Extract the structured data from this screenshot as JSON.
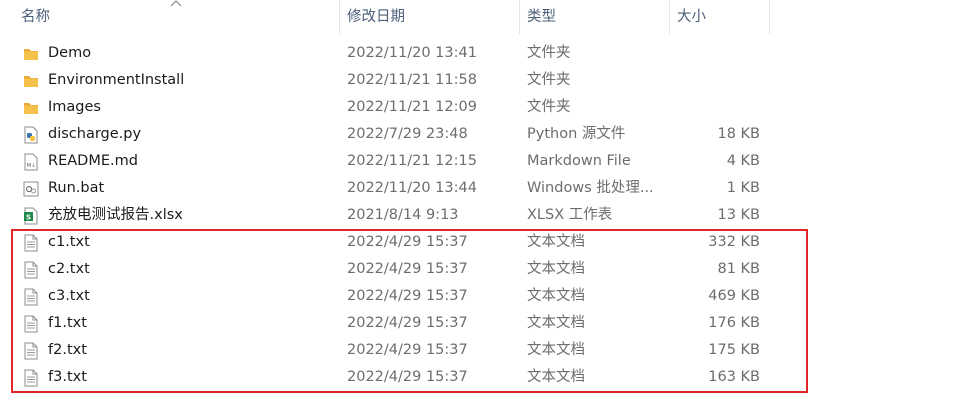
{
  "header": {
    "name": "名称",
    "date": "修改日期",
    "type": "类型",
    "size": "大小"
  },
  "files": [
    {
      "name": "Demo",
      "date": "2022/11/20 13:41",
      "type": "文件夹",
      "size": "",
      "icon": "folder-icon"
    },
    {
      "name": "EnvironmentInstall",
      "date": "2022/11/21 11:58",
      "type": "文件夹",
      "size": "",
      "icon": "folder-icon"
    },
    {
      "name": "Images",
      "date": "2022/11/21 12:09",
      "type": "文件夹",
      "size": "",
      "icon": "folder-icon"
    },
    {
      "name": "discharge.py",
      "date": "2022/7/29 23:48",
      "type": "Python 源文件",
      "size": "18 KB",
      "icon": "python-file-icon"
    },
    {
      "name": "README.md",
      "date": "2022/11/21 12:15",
      "type": "Markdown File",
      "size": "4 KB",
      "icon": "markdown-file-icon"
    },
    {
      "name": "Run.bat",
      "date": "2022/11/20 13:44",
      "type": "Windows 批处理...",
      "size": "1 KB",
      "icon": "batch-file-icon"
    },
    {
      "name": "充放电测试报告.xlsx",
      "date": "2021/8/14 9:13",
      "type": "XLSX 工作表",
      "size": "13 KB",
      "icon": "excel-file-icon"
    },
    {
      "name": "c1.txt",
      "date": "2022/4/29 15:37",
      "type": "文本文档",
      "size": "332 KB",
      "icon": "text-file-icon"
    },
    {
      "name": "c2.txt",
      "date": "2022/4/29 15:37",
      "type": "文本文档",
      "size": "81 KB",
      "icon": "text-file-icon"
    },
    {
      "name": "c3.txt",
      "date": "2022/4/29 15:37",
      "type": "文本文档",
      "size": "469 KB",
      "icon": "text-file-icon"
    },
    {
      "name": "f1.txt",
      "date": "2022/4/29 15:37",
      "type": "文本文档",
      "size": "176 KB",
      "icon": "text-file-icon"
    },
    {
      "name": "f2.txt",
      "date": "2022/4/29 15:37",
      "type": "文本文档",
      "size": "175 KB",
      "icon": "text-file-icon"
    },
    {
      "name": "f3.txt",
      "date": "2022/4/29 15:37",
      "type": "文本文档",
      "size": "163 KB",
      "icon": "text-file-icon"
    }
  ],
  "colors": {
    "highlight": "#e0252b",
    "folder": "#f5c14b",
    "header_text": "#4c607a"
  }
}
